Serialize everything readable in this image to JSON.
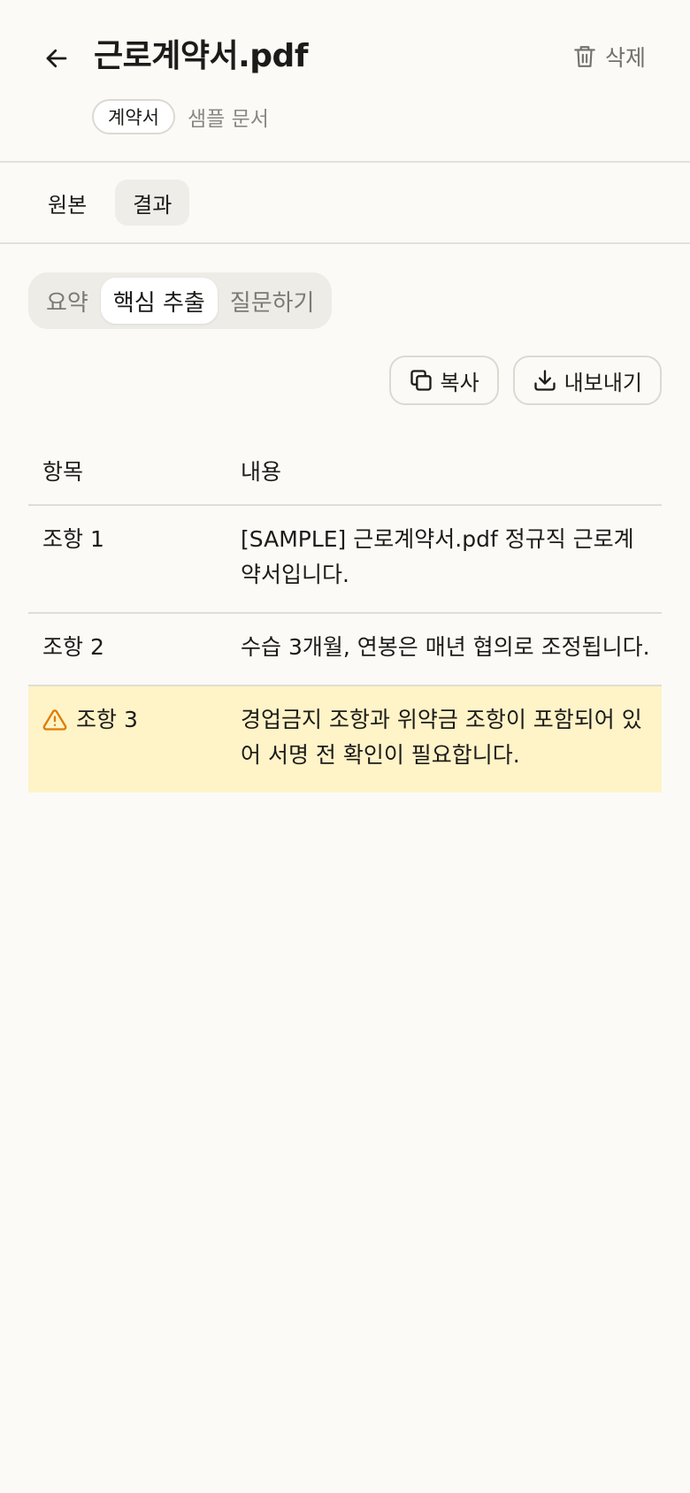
{
  "header": {
    "title": "근로계약서.pdf",
    "delete_label": "삭제",
    "tag_chip": "계약서",
    "sample_label": "샘플 문서"
  },
  "view_tabs": [
    {
      "label": "원본",
      "active": false
    },
    {
      "label": "결과",
      "active": true
    }
  ],
  "segments": [
    {
      "label": "요약",
      "active": false
    },
    {
      "label": "핵심 추출",
      "active": true
    },
    {
      "label": "질문하기",
      "active": false
    }
  ],
  "actions": {
    "copy_label": "복사",
    "export_label": "내보내기"
  },
  "table": {
    "columns": [
      "항목",
      "내용"
    ],
    "rows": [
      {
        "item": "조항 1",
        "content": "[SAMPLE] 근로계약서.pdf 정규직 근로계약서입니다.",
        "warning": false
      },
      {
        "item": "조항 2",
        "content": "수습 3개월, 연봉은 매년 협의로 조정됩니다.",
        "warning": false
      },
      {
        "item": "조항 3",
        "content": "경업금지 조항과 위약금 조항이 포함되어 있어 서명 전 확인이 필요합니다.",
        "warning": true
      }
    ]
  },
  "colors": {
    "background": "#fcfaf6",
    "warning_row": "#fff3c8",
    "warning_icon": "#e07b00"
  },
  "icons": {
    "back": "arrow-left-icon",
    "delete": "trash-icon",
    "copy": "copy-icon",
    "export": "download-icon",
    "warning": "warning-triangle-icon"
  }
}
